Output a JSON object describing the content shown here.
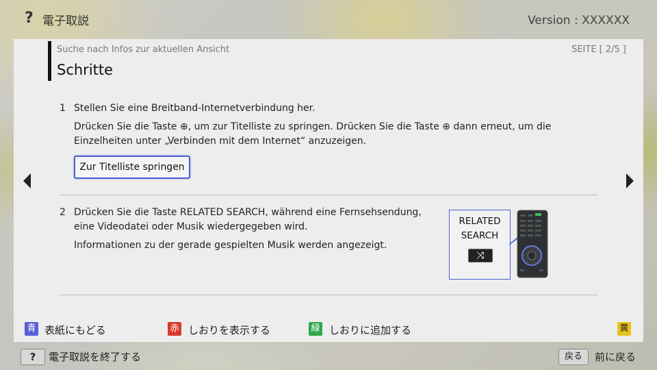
{
  "header": {
    "help_icon": "?",
    "app_title": "電子取説",
    "version": "Version : XXXXXX"
  },
  "panel": {
    "breadcrumb": "Suche nach Infos zur aktuellen Ansicht",
    "page_indicator": "SEITE [ 2/5 ]",
    "title": "Schritte"
  },
  "steps": [
    {
      "number": "1",
      "heading": "Stellen Sie eine Breitband-Internetverbindung her.",
      "body_line1": "Drücken Sie die Taste ⊕, um zur Titelliste zu springen. Drücken Sie die Taste ⊕ dann erneut, um die",
      "body_line2": "Einzelheiten unter „Verbinden mit dem Internet“ anzuzeigen.",
      "button_label": "Zur Titelliste springen"
    },
    {
      "number": "2",
      "line1": "Drücken Sie die Taste RELATED SEARCH, während eine Fernsehsendung,",
      "line2": "eine Videodatei oder Musik wiedergegeben wird.",
      "line3": "Informationen zu der gerade gespielten Musik werden angezeigt.",
      "callout_line1": "RELATED",
      "callout_line2": "SEARCH",
      "callout_key_glyph": "⤨"
    }
  ],
  "icons": {
    "prev": "arrow-left-icon",
    "next": "arrow-right-icon",
    "remote": "remote-control-icon"
  },
  "color_keys": [
    {
      "key": "青",
      "label": "表紙にもどる",
      "color": "#5a5fd6"
    },
    {
      "key": "赤",
      "label": "しおりを表示する",
      "color": "#d83a2e"
    },
    {
      "key": "緑",
      "label": "しおりに追加する",
      "color": "#2ea84a"
    },
    {
      "key": "黄",
      "label": "",
      "color": "#e8c21a"
    }
  ],
  "footer": {
    "exit_key": "?",
    "exit_label": "電子取説を終了する",
    "back_key": "戻る",
    "back_label": "前に戻る"
  }
}
